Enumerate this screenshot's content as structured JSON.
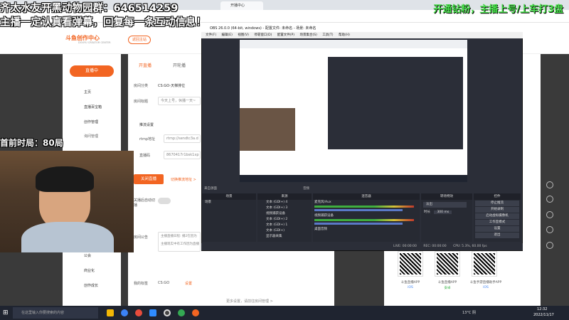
{
  "browser": {
    "tabs": [
      {
        "label": "开播中心"
      }
    ]
  },
  "overlay": {
    "line1": "齐太水友开黑动物园群：646514259",
    "line2": "主播一定认真看弹幕，回复每一条互动信息！",
    "right_text": "开通钻粉，主播上号/上车打3盘",
    "side_text": "首前时局：80局"
  },
  "site": {
    "logo": "斗鱼创作中心",
    "logo_sub": "DOUYU CREATOR CENTER",
    "header_badge": "返回主站",
    "sidebar": {
      "live_button": "直播中",
      "items": [
        {
          "label": "主页"
        },
        {
          "label": "直播百宝箱"
        },
        {
          "label": "创作管理"
        },
        {
          "label": "询问管理"
        },
        {
          "label": "公会"
        },
        {
          "label": "商业化"
        },
        {
          "label": "创作成长"
        }
      ]
    },
    "content": {
      "tabs": [
        {
          "label": "开直播"
        },
        {
          "label": "开轮播"
        }
      ],
      "room_category_label": "房间分类",
      "room_category_value": "CS:GO-天梯排位",
      "room_title_label": "房间标题",
      "room_title_value": "今天上号，休播一天~",
      "stream_settings_label": "推流设置",
      "rtmp_label": "rtmp地址",
      "rtmp_value": "rtmp://sendtc3a.d",
      "stream_code_label": "直播码",
      "stream_code_value": "8670417r1bsk1xp",
      "close_live_button": "关闭直播",
      "close_live_link": "切换推流地址 >",
      "sync_label": "关播后自动切播",
      "room_notice_label": "房间公告",
      "room_notice_value": "主播直播日程: 播2在因为主播现实中有工作因为直播",
      "my_tags_label": "我的标签",
      "my_tags_value": "CS:GO",
      "my_tags_link": "设置",
      "footer_link": "更多设置，请前往房间管理 >"
    },
    "qr_cards": [
      {
        "label": "斗鱼直播APP"
      },
      {
        "label": "斗鱼直播APP"
      },
      {
        "label": "斗鱼手游直播助手APP"
      }
    ],
    "qr_sub": [
      "iOS",
      "安卓",
      "iOS"
    ]
  },
  "obs": {
    "title": "OBS 26.0.0 (64-bit, windows) - 配置文件: 未命名 - 场景: 未命名",
    "menu": [
      "文件(F)",
      "编辑(E)",
      "视图(V)",
      "停靠窗口(D)",
      "配置文件(P)",
      "场景集合(S)",
      "工具(T)",
      "帮助(H)"
    ],
    "no_source_label": "来自源面",
    "audio_label": "音频",
    "docks": {
      "scenes": {
        "title": "场景",
        "items": [
          "场景"
        ]
      },
      "sources": {
        "title": "来源",
        "items": [
          "文本 (GDI+) 4",
          "文本 (GDI+) 3",
          "视频捕获设备",
          "文本 (GDI+) 2",
          "文本 (GDI+) 1",
          "文本 (GDI+)",
          "显示器采集"
        ]
      },
      "mixer": {
        "title": "混音器",
        "tracks": [
          {
            "name": "麦克风/Aux",
            "db": "0.0 dB"
          },
          {
            "name": "视频捕获设备",
            "db": "0.0 dB"
          },
          {
            "name": "桌面音频",
            "db": "0.0 dB"
          }
        ]
      },
      "transitions": {
        "title": "转场特效",
        "fade": "淡出",
        "duration_label": "时长",
        "duration_value": "300 ms"
      },
      "controls": {
        "title": "控件",
        "buttons": [
          "停止推流",
          "开始录制",
          "启动虚拟摄像机",
          "工作室模式",
          "设置",
          "退出"
        ]
      }
    },
    "status": {
      "live": "LIVE: 00:00:00",
      "rec": "REC: 00:00:00",
      "cpu": "CPU: 5.3%, 60.00 fps"
    }
  },
  "taskbar": {
    "search_placeholder": "在这里输入你要搜索的内容",
    "weather": "13°C 阴",
    "time": "12:32",
    "date": "2022/11/17"
  },
  "colors": {
    "accent": "#f26522",
    "overlay_green": "#47e04a",
    "obs_bg": "#2b2e38"
  }
}
